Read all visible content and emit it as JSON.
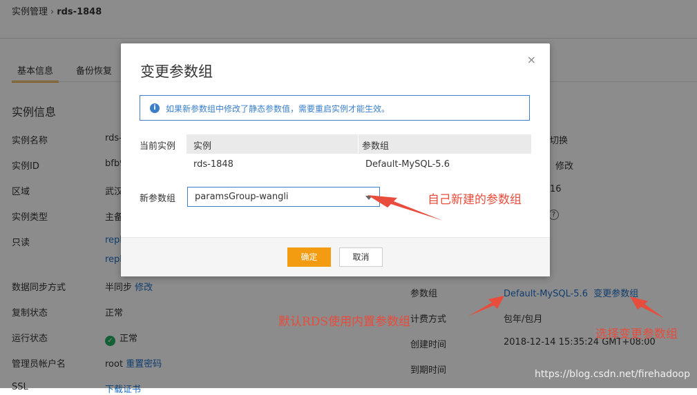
{
  "breadcrumb": {
    "parent": "实例管理",
    "current": "rds-1848"
  },
  "tabs": [
    "基本信息",
    "备份恢复"
  ],
  "section_title": "实例信息",
  "left_fields": [
    {
      "label": "实例名称",
      "value": "rds-"
    },
    {
      "label": "实例ID",
      "value": "bfb9"
    },
    {
      "label": "区域",
      "value": "武汉"
    },
    {
      "label": "实例类型",
      "value": "主备"
    },
    {
      "label": "只读",
      "value": "repl"
    },
    {
      "label": "",
      "value": "repl"
    },
    {
      "label": "数据同步方式",
      "value": "半同步",
      "link": "修改"
    },
    {
      "label": "复制状态",
      "value": "正常"
    },
    {
      "label": "运行状态",
      "value": "正常"
    },
    {
      "label": "管理员帐户名",
      "value": "root",
      "link": "重置密码"
    },
    {
      "label": "SSL",
      "value": "",
      "link": "下载证书"
    }
  ],
  "right_partial": {
    "r1": "切换",
    "r2": "修改",
    "r3": "16"
  },
  "right_fields": [
    {
      "label": "参数组",
      "value": "Default-MySQL-5.6",
      "link": "变更参数组"
    },
    {
      "label": "计费方式",
      "value": "包年/包月"
    },
    {
      "label": "创建时间",
      "value": "2018-12-14 15:35:24 GMT+08:00"
    },
    {
      "label": "到期时间",
      "value": ""
    }
  ],
  "modal": {
    "title": "变更参数组",
    "close": "×",
    "info": "如果新参数组中修改了静态参数值，需要重启实例才能生效。",
    "current_label": "当前实例",
    "table_headers": [
      "实例",
      "参数组"
    ],
    "table_row": [
      "rds-1848",
      "Default-MySQL-5.6"
    ],
    "new_label": "新参数组",
    "select_value": "paramsGroup-wangli",
    "ok": "确定",
    "cancel": "取消"
  },
  "annotations": {
    "a1": "自己新建的参数组",
    "a2": "默认RDS使用内置参数组",
    "a3": "选择变更参数组"
  },
  "watermark": "https://blog.csdn.net/firehadoop"
}
